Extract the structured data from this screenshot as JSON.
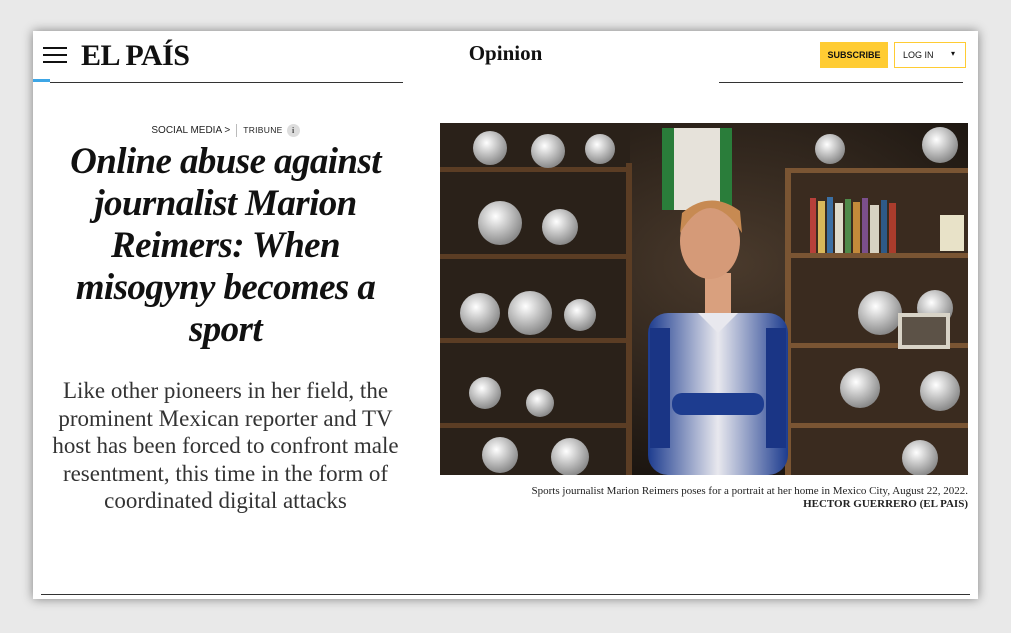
{
  "header": {
    "menu_icon": "hamburger-menu-icon",
    "logo": "EL PAÍS",
    "section": "Opinion",
    "subscribe_label": "SUBSCRIBE",
    "login_label": "LOG IN",
    "login_caret": "▾",
    "accent_color": "#ffcc33",
    "progress_color": "#3da6e6"
  },
  "article": {
    "kicker_section": "SOCIAL MEDIA >",
    "kicker_tag": "TRIBUNE",
    "info_icon": "i",
    "headline": "Online abuse against journalist Marion Reimers: When misogyny becomes a sport",
    "dek": "Like other pioneers in her field, the prominent Mexican reporter and TV host has been forced to confront male resentment, this time in the form of coordinated digital attacks"
  },
  "photo": {
    "caption": "Sports journalist Marion Reimers poses for a portrait at her home in Mexico City, August 22, 2022.",
    "credit": "HECTOR GUERRERO (EL PAIS)"
  }
}
